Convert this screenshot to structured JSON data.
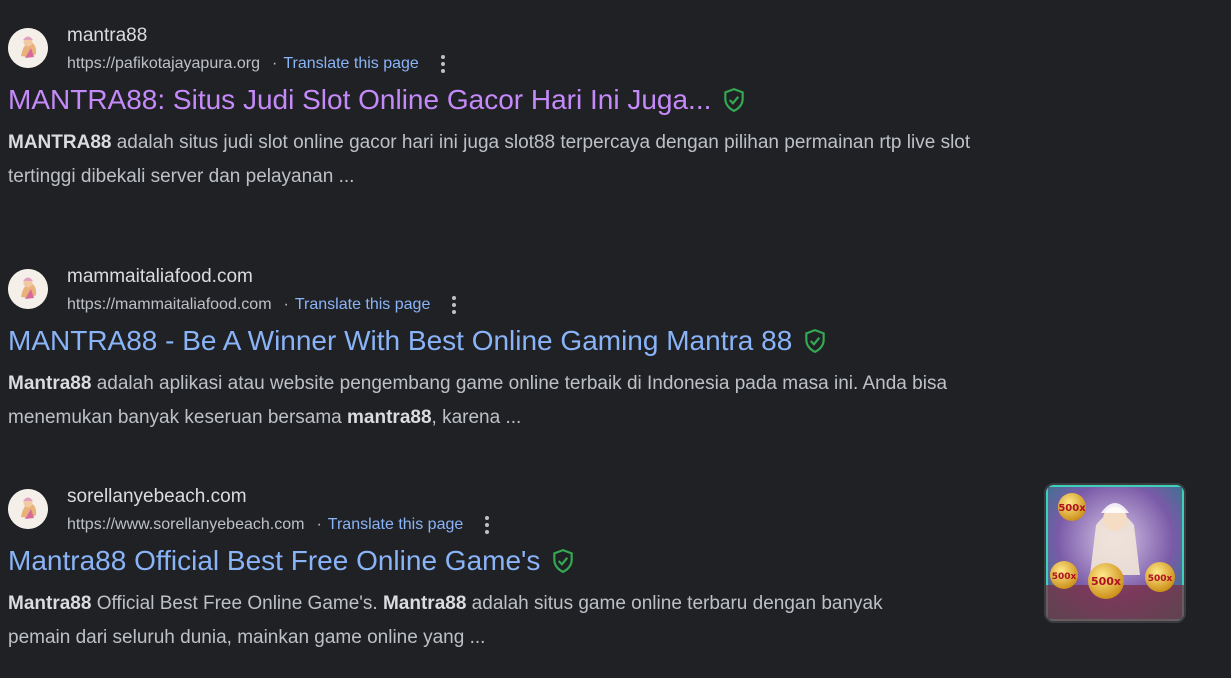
{
  "results": [
    {
      "site_name": "mantra88",
      "url": "https://pafikotajayapura.org",
      "separator": "·",
      "translate": "Translate this page",
      "title": "MANTRA88: Situs Judi Slot Online Gacor Hari Ini Juga...",
      "title_visited": true,
      "snippet_line1": {
        "bold": "MANTRA88",
        "text": " adalah situs judi slot online gacor hari ini juga slot88 terpercaya dengan pilihan permainan rtp live slot"
      },
      "snippet_line2": "tertinggi dibekali server dan pelayanan ..."
    },
    {
      "site_name": "mammaitaliafood.com",
      "url": "https://mammaitaliafood.com",
      "separator": "·",
      "translate": "Translate this page",
      "title": "MANTRA88 - Be A Winner With Best Online Gaming Mantra 88",
      "title_visited": false,
      "snippet_line1": {
        "bold": "Mantra88",
        "text": " adalah aplikasi atau website pengembang game online terbaik di Indonesia pada masa ini. Anda bisa"
      },
      "snippet_line2": {
        "pre": "menemukan banyak keseruan bersama ",
        "bold": "mantra88",
        "post": ", karena ..."
      }
    },
    {
      "site_name": "sorellanyebeach.com",
      "url": "https://www.sorellanyebeach.com",
      "separator": "·",
      "translate": "Translate this page",
      "title": "Mantra88 Official Best Free Online Game's",
      "title_visited": false,
      "snippet_line1": {
        "bold1": "Mantra88",
        "mid": " Official Best Free Online Game's. ",
        "bold2": "Mantra88",
        "post": " adalah situs game online terbaru dengan banyak"
      },
      "snippet_line2": "pemain dari seluruh dunia, mainkan game online yang ...",
      "thumbnail_icon": "slot-game-thumbnail",
      "thumbnail_text": [
        "500x",
        "500x",
        "500x",
        "500x"
      ]
    }
  ],
  "colors": {
    "background": "#202124",
    "link": "#8ab4f8",
    "visited_link": "#c58af9",
    "shield": "#34a853"
  }
}
